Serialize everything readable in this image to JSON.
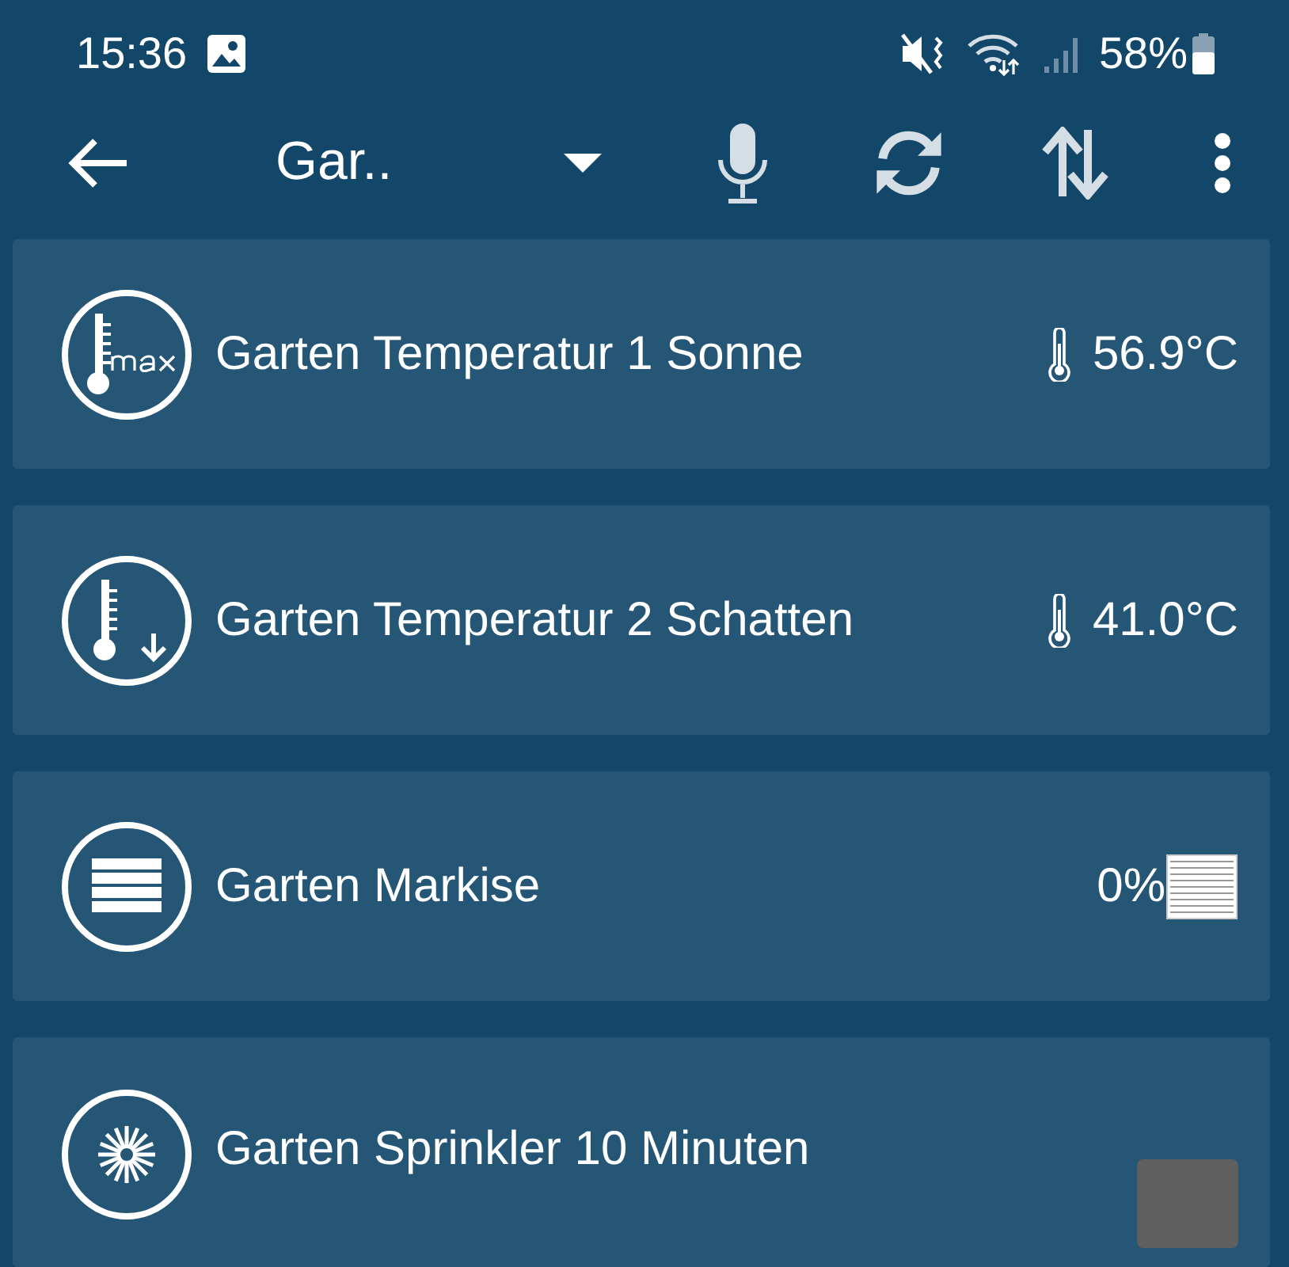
{
  "status_bar": {
    "time": "15:36",
    "battery": "58%"
  },
  "toolbar": {
    "title": "Gar.."
  },
  "devices": [
    {
      "kind": "temperature-max",
      "name": "Garten Temperatur 1 Sonne",
      "value": "56.9°C"
    },
    {
      "kind": "temperature-shade",
      "name": "Garten Temperatur 2 Schatten",
      "value": "41.0°C"
    },
    {
      "kind": "shutter",
      "name": "Garten Markise",
      "value": "0%"
    },
    {
      "kind": "switch",
      "name": "Garten Sprinkler 10 Minuten"
    }
  ]
}
